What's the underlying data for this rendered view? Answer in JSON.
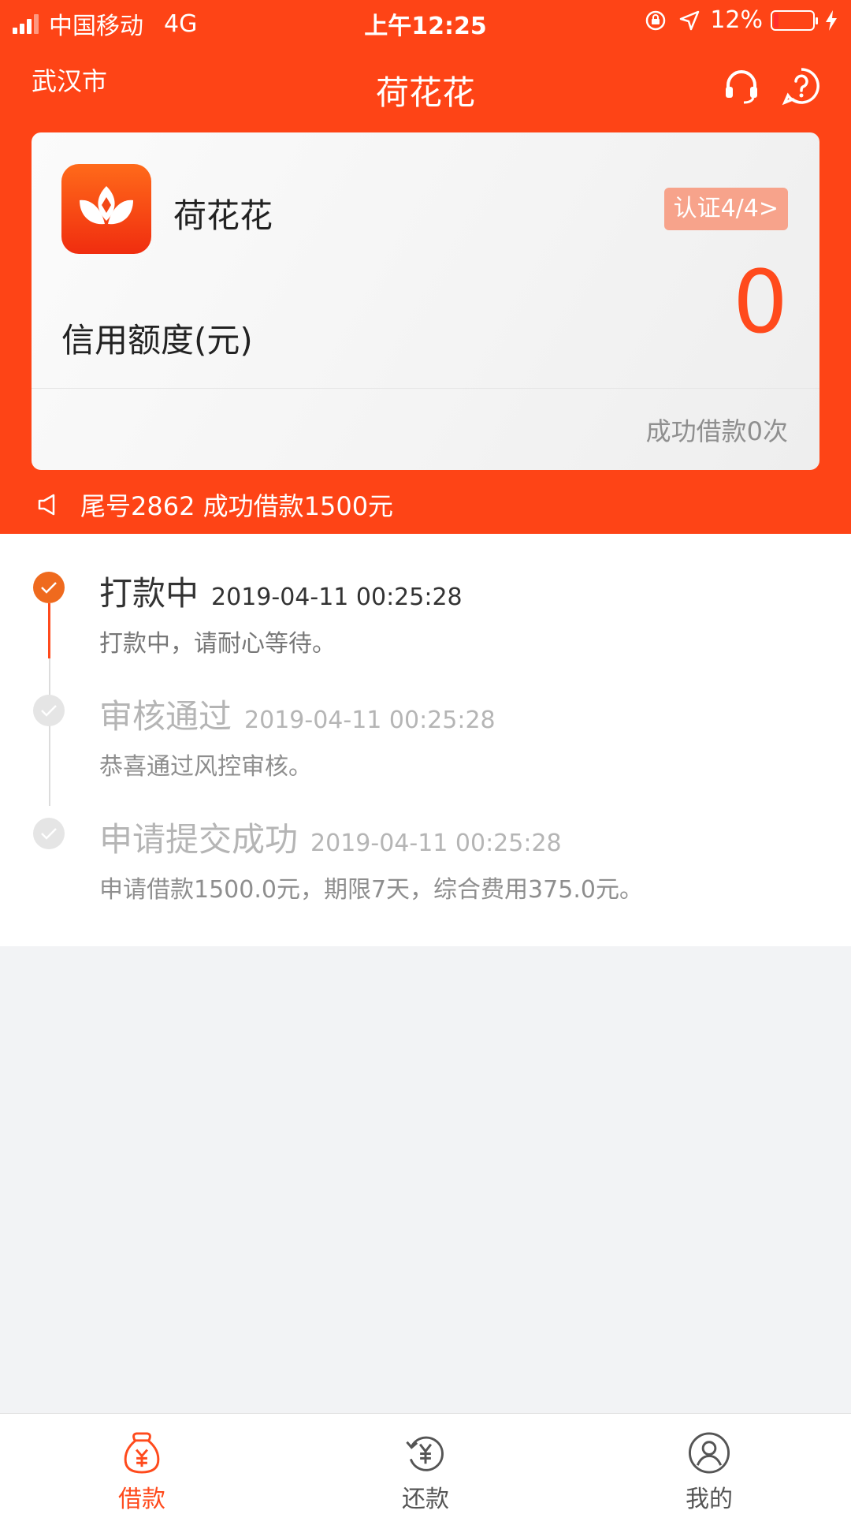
{
  "status_bar": {
    "carrier": "中国移动",
    "network": "4G",
    "time": "上午12:25",
    "battery": "12%"
  },
  "nav": {
    "city": "武汉市",
    "title": "荷花花"
  },
  "card": {
    "app_name": "荷花花",
    "cert_badge": "认证4/4>",
    "limit_label": "信用额度(元)",
    "limit_value": "0",
    "success_count": "成功借款0次"
  },
  "notice": {
    "text": "尾号2862 成功借款1500元"
  },
  "timeline": {
    "steps": [
      {
        "name": "打款中",
        "timestamp": "2019-04-11 00:25:28",
        "desc": "打款中，请耐心等待。"
      },
      {
        "name": "审核通过",
        "timestamp": "2019-04-11 00:25:28",
        "desc": "恭喜通过风控审核。"
      },
      {
        "name": "申请提交成功",
        "timestamp": "2019-04-11 00:25:28",
        "desc": "申请借款1500.0元，期限7天，综合费用375.0元。"
      }
    ]
  },
  "tabbar": {
    "tabs": [
      {
        "label": "借款",
        "icon": "money-bag-icon",
        "active": true
      },
      {
        "label": "还款",
        "icon": "repay-icon",
        "active": false
      },
      {
        "label": "我的",
        "icon": "user-icon",
        "active": false
      }
    ]
  },
  "colors": {
    "brand": "#fe4416",
    "accent": "#ff4a1c",
    "badge": "#f7a38b"
  }
}
